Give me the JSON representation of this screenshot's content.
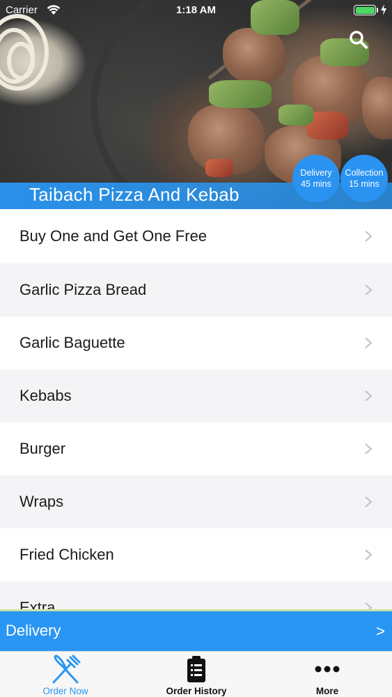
{
  "status_bar": {
    "carrier": "Carrier",
    "time": "1:18 AM"
  },
  "restaurant": {
    "name": "Taibach Pizza And Kebab"
  },
  "badges": {
    "delivery": {
      "title": "Delivery",
      "time": "45 mins"
    },
    "collection": {
      "title": "Collection",
      "time": "15 mins"
    }
  },
  "menu": {
    "items": [
      "Buy One and Get One Free",
      "Garlic Pizza Bread",
      "Garlic Baguette",
      "Kebabs",
      "Burger",
      "Wraps",
      "Fried Chicken",
      "Extra"
    ]
  },
  "order_mode": {
    "label": "Delivery",
    "arrow": ">"
  },
  "tabs": [
    {
      "label": "Order Now",
      "icon": "fork-knife-icon",
      "active": true
    },
    {
      "label": "Order History",
      "icon": "clipboard-icon",
      "active": false
    },
    {
      "label": "More",
      "icon": "more-dots-icon",
      "active": false
    }
  ],
  "colors": {
    "accent": "#2a96f3",
    "battery": "#4cd964"
  }
}
